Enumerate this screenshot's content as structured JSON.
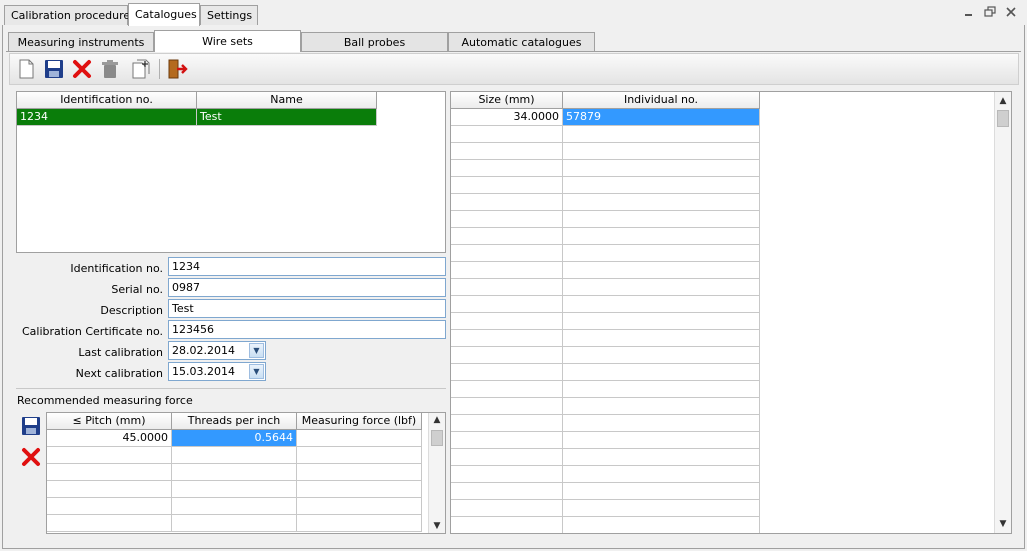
{
  "top_tabs": [
    "Calibration procedures",
    "Catalogues",
    "Settings"
  ],
  "window_controls": [
    "minimize-icon",
    "restore-icon",
    "close-icon"
  ],
  "sub_tabs": [
    "Measuring instruments",
    "Wire sets",
    "Ball probes",
    "Automatic catalogues"
  ],
  "toolbar": {
    "buttons": [
      "new-icon",
      "save-icon",
      "delete-icon",
      "trash-icon",
      "copy-icon",
      "exit-icon"
    ]
  },
  "wire_sets_table": {
    "columns": [
      "Identification no.",
      "Name"
    ],
    "rows": [
      [
        "1234",
        "Test"
      ]
    ],
    "selected_color": "#0a7d0a"
  },
  "form": {
    "identification_label": "Identification no.",
    "identification_value": "1234",
    "serial_label": "Serial no.",
    "serial_value": "0987",
    "description_label": "Description",
    "description_value": "Test",
    "certificate_label": "Calibration Certificate no.",
    "certificate_value": "123456",
    "last_calibration_label": "Last calibration",
    "last_calibration_value": "28.02.2014",
    "next_calibration_label": "Next calibration",
    "next_calibration_value": "15.03.2014"
  },
  "force_section": {
    "title": "Recommended measuring force",
    "columns": [
      "≤ Pitch (mm)",
      "Threads per inch",
      "Measuring force (lbf)"
    ],
    "rows": [
      [
        "45.0000",
        "0.5644",
        ""
      ]
    ]
  },
  "wires_table": {
    "columns": [
      "Size (mm)",
      "Individual no."
    ],
    "rows": [
      [
        "34.0000",
        "57879"
      ]
    ],
    "selected_color": "#3399ff"
  }
}
